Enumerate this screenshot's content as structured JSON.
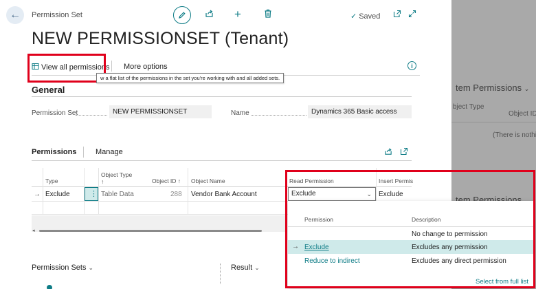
{
  "background_panel": {
    "heading": "tem Permissions",
    "heading2": "tem Permissions",
    "object_type_label": "bject Type",
    "object_id_label": "Object ID",
    "nothing_text": "(There is nothing"
  },
  "header": {
    "caption": "Permission Set",
    "title": "NEW PERMISSIONSET (Tenant)",
    "saved_label": "Saved"
  },
  "actions": {
    "view_all_label": "View all permissions",
    "more_options_label": "More options",
    "tooltip": "w a flat list of the permissions in the set you're working with and all added sets."
  },
  "general": {
    "heading": "General",
    "permission_set_label": "Permission Set",
    "permission_set_value": "NEW PERMISSIONSET",
    "name_label": "Name",
    "name_value": "Dynamics 365 Basic access"
  },
  "permissions": {
    "heading": "Permissions",
    "manage_label": "Manage",
    "columns": {
      "type": "Type",
      "object_type": "Object Type",
      "object_type_sort": "↑",
      "object_id": "Object ID ↑",
      "object_name": "Object Name",
      "read_permission": "Read Permission",
      "insert_permission": "Insert Permis"
    },
    "row": {
      "type": "Exclude",
      "object_type": "Table Data",
      "object_id": "288",
      "object_name": "Vendor Bank Account",
      "read_permission": "Exclude",
      "insert_permission": "Exclude"
    }
  },
  "dropdown": {
    "col_permission": "Permission",
    "col_description": "Description",
    "options": [
      {
        "permission": "",
        "description": "No change to permission"
      },
      {
        "permission": "Exclude",
        "description": "Excludes any permission"
      },
      {
        "permission": "Reduce to indirect",
        "description": "Excludes any direct permission"
      }
    ],
    "select_full_list": "Select from full list"
  },
  "footer": {
    "permission_sets_label": "Permission Sets",
    "result_label": "Result"
  },
  "colors": {
    "accent": "#0e7c86",
    "highlight_red": "#e0001b",
    "selected_row": "#cfeaea"
  }
}
